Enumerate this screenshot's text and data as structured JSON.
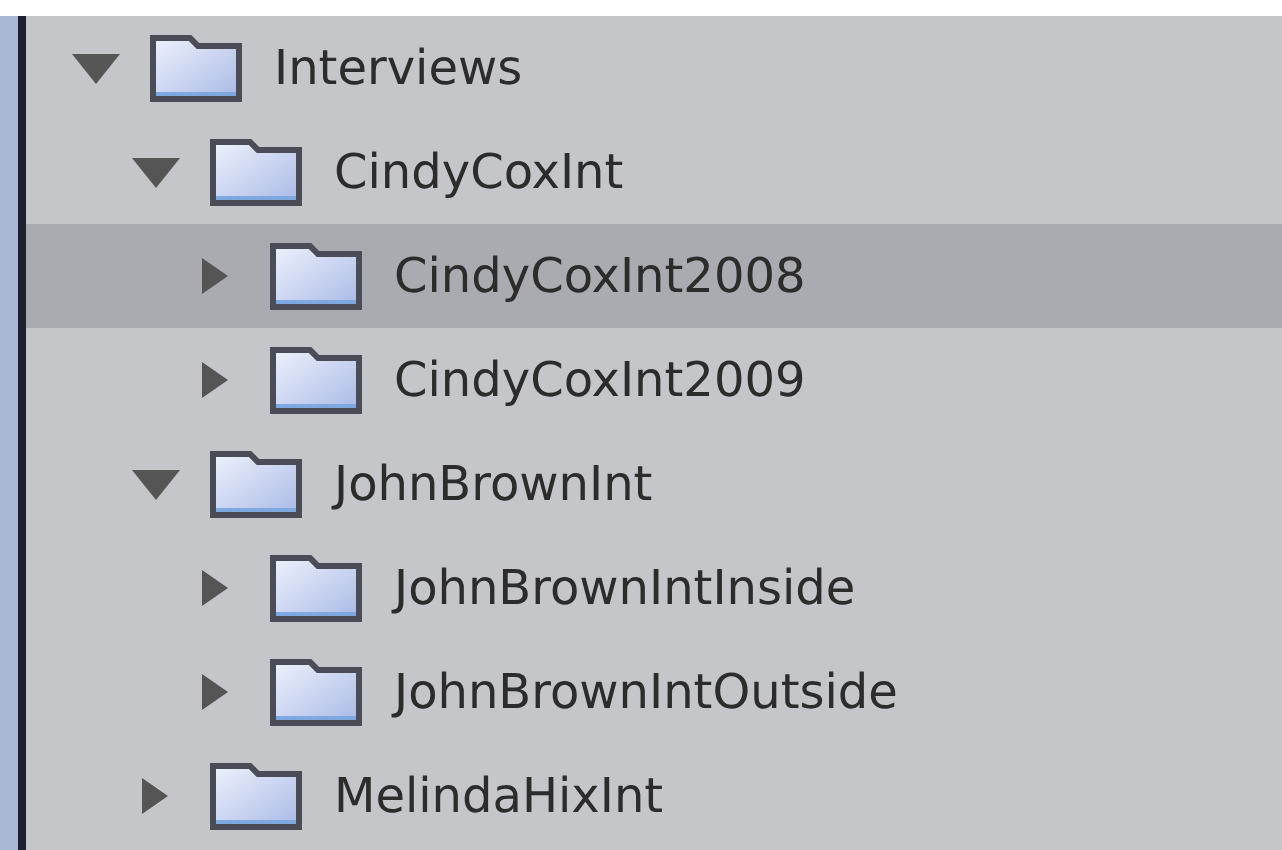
{
  "tree": [
    {
      "label": "Interviews",
      "expanded": true,
      "selected": false,
      "children": [
        {
          "label": "CindyCoxInt",
          "expanded": true,
          "selected": false,
          "children": [
            {
              "label": "CindyCoxInt2008",
              "expanded": false,
              "selected": true
            },
            {
              "label": "CindyCoxInt2009",
              "expanded": false,
              "selected": false
            }
          ]
        },
        {
          "label": "JohnBrownInt",
          "expanded": true,
          "selected": false,
          "children": [
            {
              "label": "JohnBrownIntInside",
              "expanded": false,
              "selected": false
            },
            {
              "label": "JohnBrownIntOutside",
              "expanded": false,
              "selected": false
            }
          ]
        },
        {
          "label": "MelindaHixInt",
          "expanded": false,
          "selected": false
        }
      ]
    }
  ]
}
